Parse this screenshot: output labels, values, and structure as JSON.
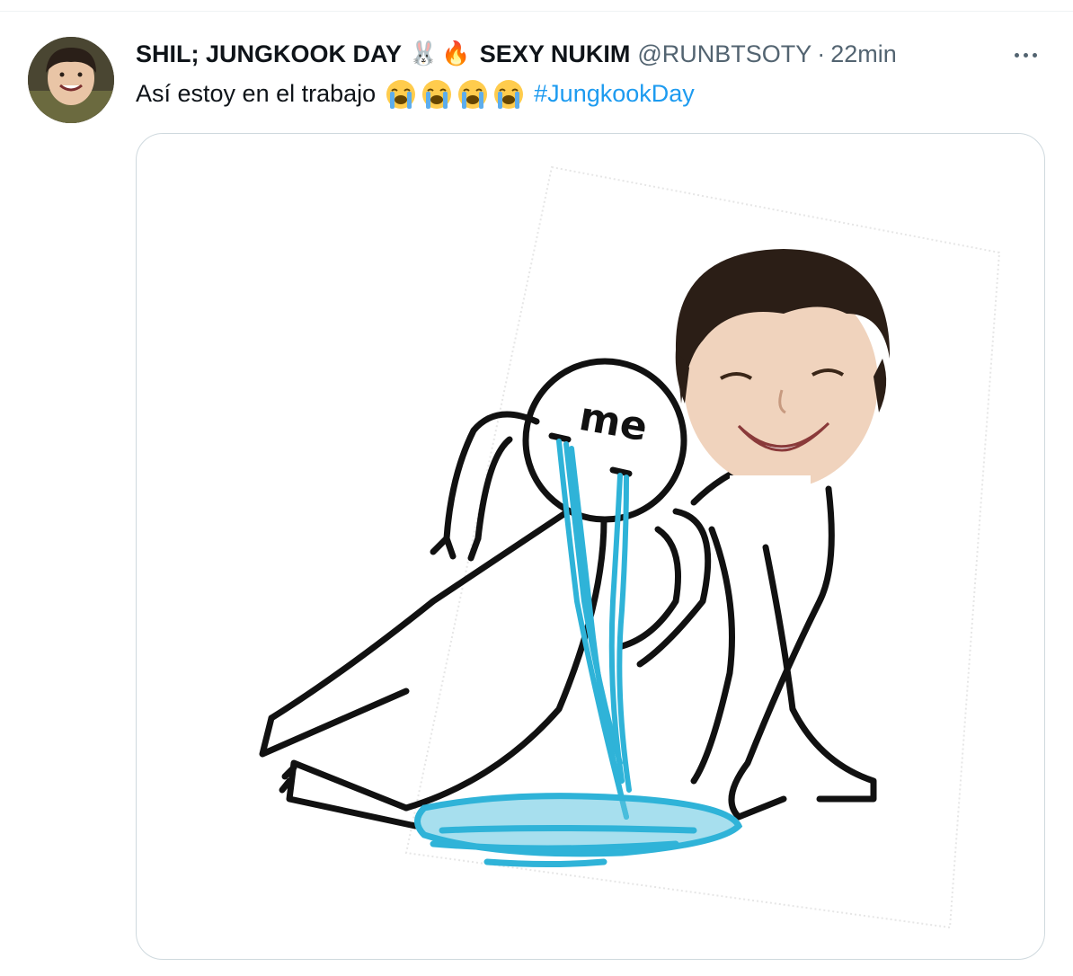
{
  "tweet": {
    "display_name_part1": "SHIL; JUNGKOOK DAY",
    "display_name_emojis": [
      "🐰",
      "🔥"
    ],
    "display_name_part2": "SEXY NUKIM",
    "handle": "@RUNBTSOTY",
    "separator": "·",
    "timestamp": "22min",
    "text": "Así estoy en el trabajo",
    "crying_emoji_count": 4,
    "hashtag": "#JungkookDay",
    "more_icon": "more-horizontal-icon"
  },
  "media": {
    "caption_on_image": "me",
    "colors": {
      "tears": "#2fb3d8",
      "ink": "#111111",
      "hashtag": "#1d9bf0",
      "secondary_text": "#536471"
    }
  }
}
